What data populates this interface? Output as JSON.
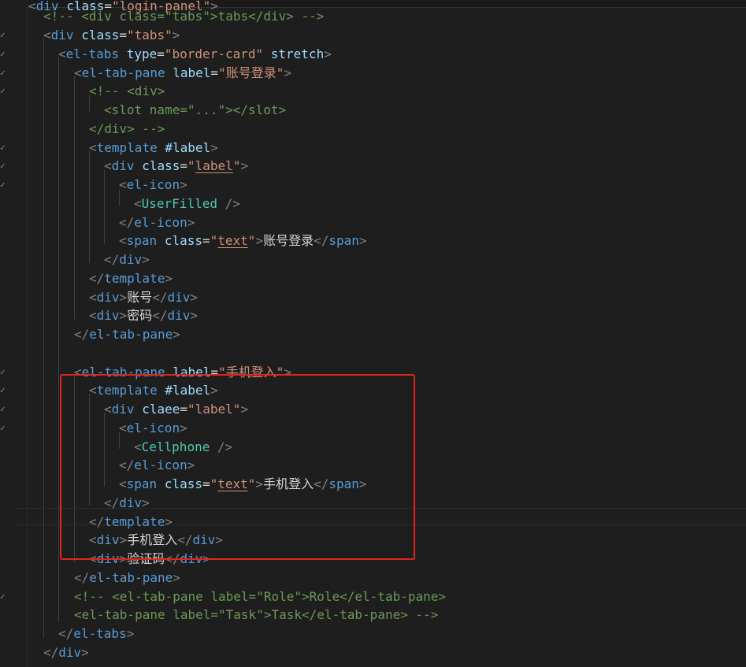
{
  "editor": {
    "language": "vue",
    "theme_colors": {
      "background": "#1e1e1e",
      "tag": "#569cd6",
      "attribute": "#9cdcfe",
      "string": "#ce9178",
      "text": "#d4d4d4",
      "punctuation": "#808080",
      "highlight_box": "#e0241f"
    },
    "lines": [
      {
        "id": 0,
        "check": "",
        "tokens": [
          [
            "p",
            "<"
          ],
          [
            "t",
            "div"
          ],
          [
            "x",
            " "
          ],
          [
            "a",
            "class"
          ],
          [
            "x",
            "="
          ],
          [
            "s",
            "\"login-panel\""
          ],
          [
            "p",
            ">"
          ]
        ]
      },
      {
        "id": 1,
        "check": "",
        "tokens": [
          [
            "c",
            "<!-- <div class=\"tabs\">tabs</div> -->"
          ]
        ]
      },
      {
        "id": 2,
        "check": "✓",
        "tokens": [
          [
            "p",
            "<"
          ],
          [
            "t",
            "div"
          ],
          [
            "x",
            " "
          ],
          [
            "a",
            "class"
          ],
          [
            "x",
            "="
          ],
          [
            "s",
            "\"tabs\""
          ],
          [
            "p",
            ">"
          ]
        ]
      },
      {
        "id": 3,
        "check": "✓",
        "tokens": [
          [
            "p",
            "<"
          ],
          [
            "t",
            "el-tabs"
          ],
          [
            "x",
            " "
          ],
          [
            "a",
            "type"
          ],
          [
            "x",
            "="
          ],
          [
            "s",
            "\"border-card\""
          ],
          [
            "x",
            " "
          ],
          [
            "a",
            "stretch"
          ],
          [
            "p",
            ">"
          ]
        ]
      },
      {
        "id": 4,
        "check": "✓",
        "tokens": [
          [
            "p",
            "<"
          ],
          [
            "t",
            "el-tab-pane"
          ],
          [
            "x",
            " "
          ],
          [
            "a",
            "label"
          ],
          [
            "x",
            "="
          ],
          [
            "s",
            "\"账号登录\""
          ],
          [
            "p",
            ">"
          ]
        ]
      },
      {
        "id": 5,
        "check": "✓",
        "tokens": [
          [
            "c",
            "<!-- <div>"
          ]
        ]
      },
      {
        "id": 6,
        "check": "",
        "tokens": [
          [
            "c",
            "<slot name=\"...\"></slot>"
          ]
        ]
      },
      {
        "id": 7,
        "check": "",
        "tokens": [
          [
            "c",
            "</div> -->"
          ]
        ]
      },
      {
        "id": 8,
        "check": "✓",
        "tokens": [
          [
            "p",
            "<"
          ],
          [
            "t",
            "template"
          ],
          [
            "x",
            " "
          ],
          [
            "a",
            "#label"
          ],
          [
            "p",
            ">"
          ]
        ]
      },
      {
        "id": 9,
        "check": "✓",
        "tokens": [
          [
            "p",
            "<"
          ],
          [
            "t",
            "div"
          ],
          [
            "x",
            " "
          ],
          [
            "a",
            "class"
          ],
          [
            "x",
            "="
          ],
          [
            "s",
            "\"",
            "label",
            "\""
          ],
          [
            "p",
            ">"
          ]
        ]
      },
      {
        "id": 10,
        "check": "✓",
        "tokens": [
          [
            "p",
            "<"
          ],
          [
            "t",
            "el-icon"
          ],
          [
            "p",
            ">"
          ]
        ]
      },
      {
        "id": 11,
        "check": "",
        "tokens": [
          [
            "p",
            "<"
          ],
          [
            "comp",
            "UserFilled"
          ],
          [
            "x",
            " "
          ],
          [
            "p",
            "/>"
          ]
        ]
      },
      {
        "id": 12,
        "check": "",
        "tokens": [
          [
            "p",
            "</"
          ],
          [
            "t",
            "el-icon"
          ],
          [
            "p",
            ">"
          ]
        ]
      },
      {
        "id": 13,
        "check": "",
        "tokens": [
          [
            "p",
            "<"
          ],
          [
            "t",
            "span"
          ],
          [
            "x",
            " "
          ],
          [
            "a",
            "class"
          ],
          [
            "x",
            "="
          ],
          [
            "s",
            "\"",
            "text",
            "\""
          ],
          [
            "p",
            ">"
          ],
          [
            "x",
            "账号登录"
          ],
          [
            "p",
            "</"
          ],
          [
            "t",
            "span"
          ],
          [
            "p",
            ">"
          ]
        ]
      },
      {
        "id": 14,
        "check": "",
        "tokens": [
          [
            "p",
            "</"
          ],
          [
            "t",
            "div"
          ],
          [
            "p",
            ">"
          ]
        ]
      },
      {
        "id": 15,
        "check": "",
        "tokens": [
          [
            "p",
            "</"
          ],
          [
            "t",
            "template"
          ],
          [
            "p",
            ">"
          ]
        ]
      },
      {
        "id": 16,
        "check": "",
        "tokens": [
          [
            "p",
            "<"
          ],
          [
            "t",
            "div"
          ],
          [
            "p",
            ">"
          ],
          [
            "x",
            "账号"
          ],
          [
            "p",
            "</"
          ],
          [
            "t",
            "div"
          ],
          [
            "p",
            ">"
          ]
        ]
      },
      {
        "id": 17,
        "check": "",
        "tokens": [
          [
            "p",
            "<"
          ],
          [
            "t",
            "div"
          ],
          [
            "p",
            ">"
          ],
          [
            "x",
            "密码"
          ],
          [
            "p",
            "</"
          ],
          [
            "t",
            "div"
          ],
          [
            "p",
            ">"
          ]
        ]
      },
      {
        "id": 18,
        "check": "",
        "tokens": [
          [
            "p",
            "</"
          ],
          [
            "t",
            "el-tab-pane"
          ],
          [
            "p",
            ">"
          ]
        ]
      },
      {
        "id": 19,
        "check": "",
        "tokens": []
      },
      {
        "id": 20,
        "check": "✓",
        "tokens": [
          [
            "p",
            "<"
          ],
          [
            "t",
            "el-tab-pane"
          ],
          [
            "x",
            " "
          ],
          [
            "a",
            "label"
          ],
          [
            "x",
            "="
          ],
          [
            "s",
            "\"手机登入\""
          ],
          [
            "p",
            ">"
          ]
        ]
      },
      {
        "id": 21,
        "check": "✓",
        "tokens": [
          [
            "p",
            "<"
          ],
          [
            "t",
            "template"
          ],
          [
            "x",
            " "
          ],
          [
            "a",
            "#label"
          ],
          [
            "p",
            ">"
          ]
        ]
      },
      {
        "id": 22,
        "check": "✓",
        "tokens": [
          [
            "p",
            "<"
          ],
          [
            "t",
            "div"
          ],
          [
            "x",
            " "
          ],
          [
            "a",
            "claee"
          ],
          [
            "x",
            "="
          ],
          [
            "s",
            "\"label\""
          ],
          [
            "p",
            ">"
          ]
        ]
      },
      {
        "id": 23,
        "check": "✓",
        "tokens": [
          [
            "p",
            "<"
          ],
          [
            "t",
            "el-icon"
          ],
          [
            "p",
            ">"
          ]
        ]
      },
      {
        "id": 24,
        "check": "",
        "tokens": [
          [
            "p",
            "<"
          ],
          [
            "comp",
            "Cellphone"
          ],
          [
            "x",
            " "
          ],
          [
            "p",
            "/>"
          ]
        ]
      },
      {
        "id": 25,
        "check": "",
        "tokens": [
          [
            "p",
            "</"
          ],
          [
            "t",
            "el-icon"
          ],
          [
            "p",
            ">"
          ]
        ]
      },
      {
        "id": 26,
        "check": "",
        "tokens": [
          [
            "p",
            "<"
          ],
          [
            "t",
            "span"
          ],
          [
            "x",
            " "
          ],
          [
            "a",
            "class"
          ],
          [
            "x",
            "="
          ],
          [
            "s",
            "\"",
            "text",
            "\""
          ],
          [
            "p",
            ">"
          ],
          [
            "x",
            "手机登入"
          ],
          [
            "p",
            "</"
          ],
          [
            "t",
            "span"
          ],
          [
            "p",
            ">"
          ]
        ]
      },
      {
        "id": 27,
        "check": "",
        "tokens": [
          [
            "p",
            "</"
          ],
          [
            "t",
            "div"
          ],
          [
            "p",
            ">"
          ]
        ]
      },
      {
        "id": 28,
        "check": "",
        "tokens": [
          [
            "p",
            "</"
          ],
          [
            "t",
            "template"
          ],
          [
            "p",
            ">"
          ]
        ]
      },
      {
        "id": 29,
        "check": "",
        "tokens": [
          [
            "p",
            "<"
          ],
          [
            "t",
            "div"
          ],
          [
            "p",
            ">"
          ],
          [
            "x",
            "手机登入"
          ],
          [
            "p",
            "</"
          ],
          [
            "t",
            "div"
          ],
          [
            "p",
            ">"
          ]
        ]
      },
      {
        "id": 30,
        "check": "",
        "tokens": [
          [
            "p",
            "<"
          ],
          [
            "t",
            "div"
          ],
          [
            "p",
            ">"
          ],
          [
            "x",
            "验证码"
          ],
          [
            "p",
            "</"
          ],
          [
            "t",
            "div"
          ],
          [
            "p",
            ">"
          ]
        ]
      },
      {
        "id": 31,
        "check": "",
        "tokens": [
          [
            "p",
            "</"
          ],
          [
            "t",
            "el-tab-pane"
          ],
          [
            "p",
            ">"
          ]
        ]
      },
      {
        "id": 32,
        "check": "✓",
        "tokens": [
          [
            "c",
            "<!-- <el-tab-pane label=\"Role\">Role</el-tab-pane>"
          ]
        ]
      },
      {
        "id": 33,
        "check": "",
        "tokens": [
          [
            "c",
            "<el-tab-pane label=\"Task\">Task</el-tab-pane> -->"
          ]
        ]
      },
      {
        "id": 34,
        "check": "",
        "tokens": [
          [
            "p",
            "</"
          ],
          [
            "t",
            "el-tabs"
          ],
          [
            "p",
            ">"
          ]
        ]
      },
      {
        "id": 35,
        "check": "",
        "tokens": [
          [
            "p",
            "</"
          ],
          [
            "t",
            "div"
          ],
          [
            "p",
            ">"
          ]
        ]
      }
    ]
  }
}
